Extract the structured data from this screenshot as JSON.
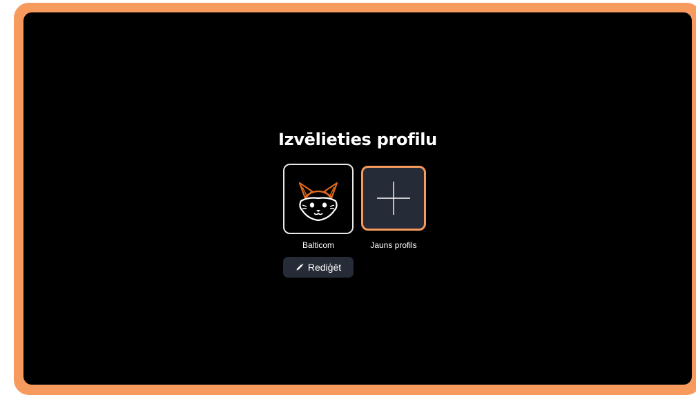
{
  "screen": {
    "title": "Izvēlieties profilu"
  },
  "profiles": [
    {
      "name": "Balticom",
      "icon": "fox-avatar-icon",
      "selected": false
    },
    {
      "name": "Jauns profils",
      "icon": "plus-icon",
      "selected": true
    }
  ],
  "edit_button": {
    "label": "Rediģēt",
    "icon": "pencil-icon"
  },
  "colors": {
    "accent": "#f79a5e",
    "background": "#000000",
    "tile": "#262b38",
    "text": "#ffffff"
  }
}
